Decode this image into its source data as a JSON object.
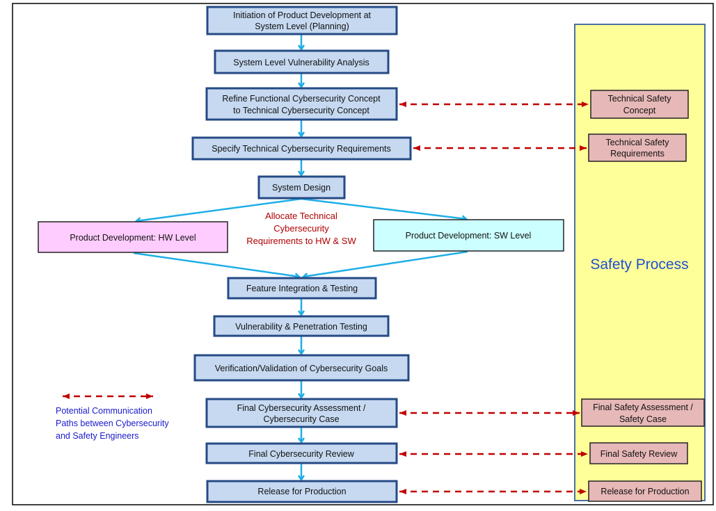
{
  "flow": {
    "b1": [
      "Initiation of Product Development at",
      "System Level (Planning)"
    ],
    "b2": [
      "System Level Vulnerability Analysis"
    ],
    "b3": [
      "Refine Functional Cybersecurity Concept",
      "to Technical Cybersecurity Concept"
    ],
    "b4": [
      "Specify Technical Cybersecurity Requirements"
    ],
    "b5": [
      "System Design"
    ],
    "hw": [
      "Product Development: HW Level"
    ],
    "sw": [
      "Product Development: SW Level"
    ],
    "b6": [
      "Feature Integration & Testing"
    ],
    "b7": [
      "Vulnerability & Penetration  Testing"
    ],
    "b8": [
      "Verification/Validation of Cybersecurity Goals"
    ],
    "b9": [
      "Final Cybersecurity Assessment /",
      "Cybersecurity Case"
    ],
    "b10": [
      "Final Cybersecurity Review"
    ],
    "b11": [
      "Release for Production"
    ]
  },
  "allocate_note": [
    "Allocate Technical",
    "Cybersecurity",
    "Requirements to HW & SW"
  ],
  "safety": {
    "title": "Safety Process",
    "s1": [
      "Technical Safety",
      "Concept"
    ],
    "s2": [
      "Technical Safety",
      "Requirements"
    ],
    "s3": [
      "Final Safety Assessment /",
      "Safety Case"
    ],
    "s4": [
      "Final Safety Review"
    ],
    "s5": [
      "Release for Production"
    ]
  },
  "legend": [
    "Potential Communication",
    "Paths between Cybersecurity",
    "and Safety Engineers"
  ],
  "colors": {
    "box_fill": "#c6d9f1",
    "flow_arrow": "#1eaee6",
    "comm_arrow": "#c00000",
    "safety_panel": "#ffff99",
    "safety_box": "#e6b8b7",
    "hw_fill": "#ffccff",
    "sw_fill": "#ccffff"
  }
}
